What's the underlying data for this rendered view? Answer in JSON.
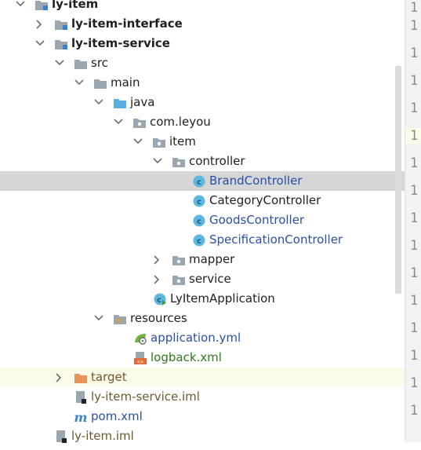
{
  "tree": {
    "ly_item": "ly-item",
    "ly_item_interface": "ly-item-interface",
    "ly_item_service": "ly-item-service",
    "src": "src",
    "main": "main",
    "java": "java",
    "com_leyou": "com.leyou",
    "item": "item",
    "controller": "controller",
    "brand_controller": "BrandController",
    "category_controller": "CategoryController",
    "goods_controller": "GoodsController",
    "specification_controller": "SpecificationController",
    "mapper": "mapper",
    "service": "service",
    "ly_item_application": "LyItemApplication",
    "resources": "resources",
    "application_yml": "application.yml",
    "logback_xml": "logback.xml",
    "target": "target",
    "ly_item_service_iml": "ly-item-service.iml",
    "pom_xml": "pom.xml",
    "ly_item_iml": "ly-item.iml"
  },
  "gutter": {
    "line_marker": "1"
  },
  "colors": {
    "selected_row": "#d6d6d6",
    "highlight_row": "#fbfbe9",
    "class_icon": "#5db7de",
    "folder": "#9aa7b0",
    "source_folder": "#5ab0e0"
  }
}
